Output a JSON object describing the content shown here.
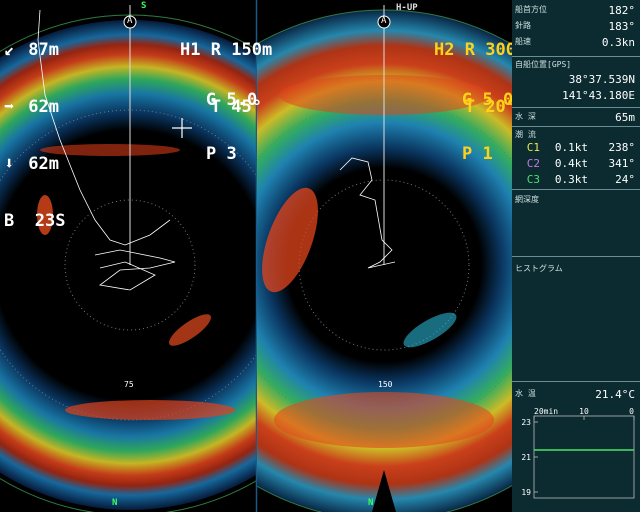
{
  "left_display": {
    "stats": [
      {
        "icon": "depth-down-left-arrow-icon",
        "value": "87m"
      },
      {
        "icon": "right-arrow-icon",
        "value": "62m"
      },
      {
        "icon": "down-arrow-icon",
        "value": "62m"
      }
    ],
    "b_label": "B",
    "b_value": "23S",
    "h_label": "H1",
    "r_label": "R",
    "r_value": "150m",
    "t_label": "T",
    "t_value": "45°",
    "g_label": "G",
    "g_value": "5.0",
    "p_label": "P",
    "p_value": "3",
    "compass_top": "S",
    "compass_bottom": "N",
    "range_ring_label": "75",
    "marker": "A"
  },
  "right_display": {
    "mode": "H-UP",
    "h_label": "H2",
    "r_label": "R",
    "r_value": "300m",
    "t_label": "T",
    "t_value": "20°",
    "g_label": "G",
    "g_value": "5.0",
    "p_label": "P",
    "p_value": "1",
    "compass_bottom": "N",
    "range_ring_label": "150",
    "marker": "A"
  },
  "side_panel": {
    "bearing_label": "船首方位",
    "bearing_value": "182°",
    "course_label": "針路",
    "course_value": "183°",
    "speed_label": "船速",
    "speed_value": "0.3kn",
    "position_label": "自船位置[GPS]",
    "lat": "38°37.539N",
    "lon": "141°43.180E",
    "depth_label": "水 深",
    "depth_value": "65m",
    "current_label": "潮 流",
    "currents": [
      {
        "name": "C1",
        "speed": "0.1kt",
        "dir": "238°"
      },
      {
        "name": "C2",
        "speed": "0.4kt",
        "dir": "341°"
      },
      {
        "name": "C3",
        "speed": "0.3kt",
        "dir": "24°"
      }
    ],
    "net_depth_label": "網深度",
    "histogram_label": "ヒストグラム",
    "temp_label": "水 温",
    "temp_value": "21.4°C",
    "temp_graph": {
      "x_ticks": [
        "20min",
        "10",
        "0"
      ],
      "y_ticks": [
        "23",
        "21",
        "19"
      ],
      "values": [
        21.4,
        21.4,
        21.4,
        21.4,
        21.4,
        21.4
      ]
    }
  },
  "colors": {
    "panel_bg": "#0b2b30",
    "compass": "#36ff66",
    "highlight": "#ffd21a",
    "c1": "#f0e84a",
    "c2": "#c97adf",
    "c3": "#49e36a"
  }
}
